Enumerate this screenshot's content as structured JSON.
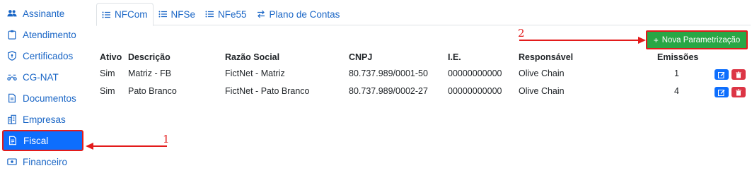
{
  "sidebar": {
    "items": [
      {
        "label": "Assinante",
        "icon": "users-icon"
      },
      {
        "label": "Atendimento",
        "icon": "clipboard-icon"
      },
      {
        "label": "Certificados",
        "icon": "shield-icon"
      },
      {
        "label": "CG-NAT",
        "icon": "network-icon"
      },
      {
        "label": "Documentos",
        "icon": "document-icon"
      },
      {
        "label": "Empresas",
        "icon": "building-icon"
      },
      {
        "label": "Fiscal",
        "icon": "receipt-icon",
        "active": true
      },
      {
        "label": "Financeiro",
        "icon": "money-icon"
      }
    ]
  },
  "tabs": [
    {
      "label": "NFCom",
      "icon": "list-icon",
      "active": true
    },
    {
      "label": "NFSe",
      "icon": "list-icon"
    },
    {
      "label": "NFe55",
      "icon": "list-icon"
    },
    {
      "label": "Plano de Contas",
      "icon": "exchange-icon"
    }
  ],
  "new_button": {
    "label": "Nova Parametrização",
    "icon": "plus-icon"
  },
  "table": {
    "headers": {
      "ativo": "Ativo",
      "descricao": "Descrição",
      "razao": "Razão Social",
      "cnpj": "CNPJ",
      "ie": "I.E.",
      "responsavel": "Responsável",
      "emissoes": "Emissões"
    },
    "rows": [
      {
        "ativo": "Sim",
        "descricao": "Matriz - FB",
        "razao": "FictNet - Matriz",
        "cnpj": "80.737.989/0001-50",
        "ie": "00000000000",
        "responsavel": "Olive Chain",
        "emissoes": "1"
      },
      {
        "ativo": "Sim",
        "descricao": "Pato Branco",
        "razao": "FictNet - Pato Branco",
        "cnpj": "80.737.989/0002-27",
        "ie": "00000000000",
        "responsavel": "Olive Chain",
        "emissoes": "4"
      }
    ]
  },
  "annotations": {
    "one": "1",
    "two": "2"
  },
  "colors": {
    "link": "#1a66c6",
    "primary": "#0d6efd",
    "success": "#28a745",
    "danger": "#dc3545",
    "annotation": "#e31b1b"
  }
}
